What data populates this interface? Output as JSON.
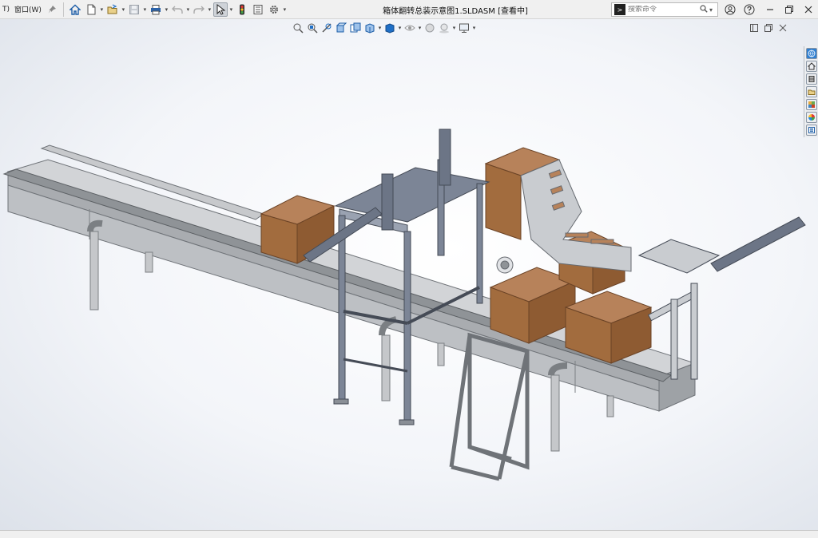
{
  "menu": {
    "items": [
      "T)",
      "窗口(W)"
    ]
  },
  "window": {
    "title": "箱体翻转总装示意图1.SLDASM [查看中]"
  },
  "search": {
    "placeholder": "搜索命令"
  },
  "colors": {
    "accent": "#1f6fc6",
    "box": "#a26c3e",
    "frame": "#7c8596",
    "conveyor": "#b9bcc0"
  },
  "icons": {
    "toolbar": [
      "pin-icon",
      "home-icon",
      "new-document-icon",
      "open-folder-icon",
      "save-icon",
      "print-icon",
      "undo-icon",
      "redo-icon",
      "select-cursor-icon",
      "traffic-light-icon",
      "file-properties-icon",
      "gear-icon"
    ],
    "window_controls": [
      "user-icon",
      "help-icon",
      "minimize-icon",
      "restore-icon",
      "close-icon"
    ],
    "task_pane": [
      "globe-icon",
      "home-icon",
      "parts-library-icon",
      "folder-icon",
      "appearance-icon",
      "color-wheel-icon",
      "properties-icon"
    ]
  }
}
